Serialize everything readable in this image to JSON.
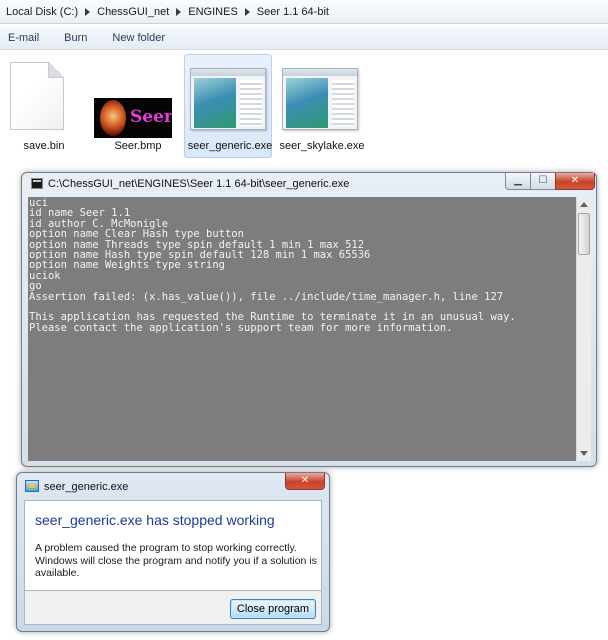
{
  "explorer": {
    "breadcrumb": [
      "Local Disk (C:)",
      "ChessGUI_net",
      "ENGINES",
      "Seer 1.1 64-bit"
    ],
    "toolbar": {
      "email": "E-mail",
      "burn": "Burn",
      "new_folder": "New folder"
    },
    "files": [
      {
        "name": "save.bin",
        "icon": "document-icon"
      },
      {
        "name": "Seer.bmp",
        "icon": "image-thumbnail",
        "thumb_text": "Seer"
      },
      {
        "name": "seer_generic.exe",
        "icon": "application-icon",
        "selected": true
      },
      {
        "name": "seer_skylake.exe",
        "icon": "application-icon"
      }
    ]
  },
  "console": {
    "title": "C:\\ChessGUI_net\\ENGINES\\Seer 1.1 64-bit\\seer_generic.exe",
    "lines": [
      "uci",
      "id name Seer 1.1",
      "id author C. McMonigle",
      "option name Clear Hash type button",
      "option name Threads type spin default 1 min 1 max 512",
      "option name Hash type spin default 128 min 1 max 65536",
      "option name Weights type string",
      "uciok",
      "go",
      "Assertion failed: (x.has_value()), file ../include/time_manager.h, line 127",
      "",
      "This application has requested the Runtime to terminate it in an unusual way.",
      "Please contact the application's support team for more information."
    ],
    "colors": {
      "background": "#7d7d7d",
      "text": "#f2f2f2"
    }
  },
  "dialog": {
    "title": "seer_generic.exe",
    "heading": "seer_generic.exe has stopped working",
    "message": "A problem caused the program to stop working correctly. Windows will close the program and notify you if a solution is available.",
    "button": "Close program",
    "colors": {
      "heading": "#1f3a93"
    }
  }
}
